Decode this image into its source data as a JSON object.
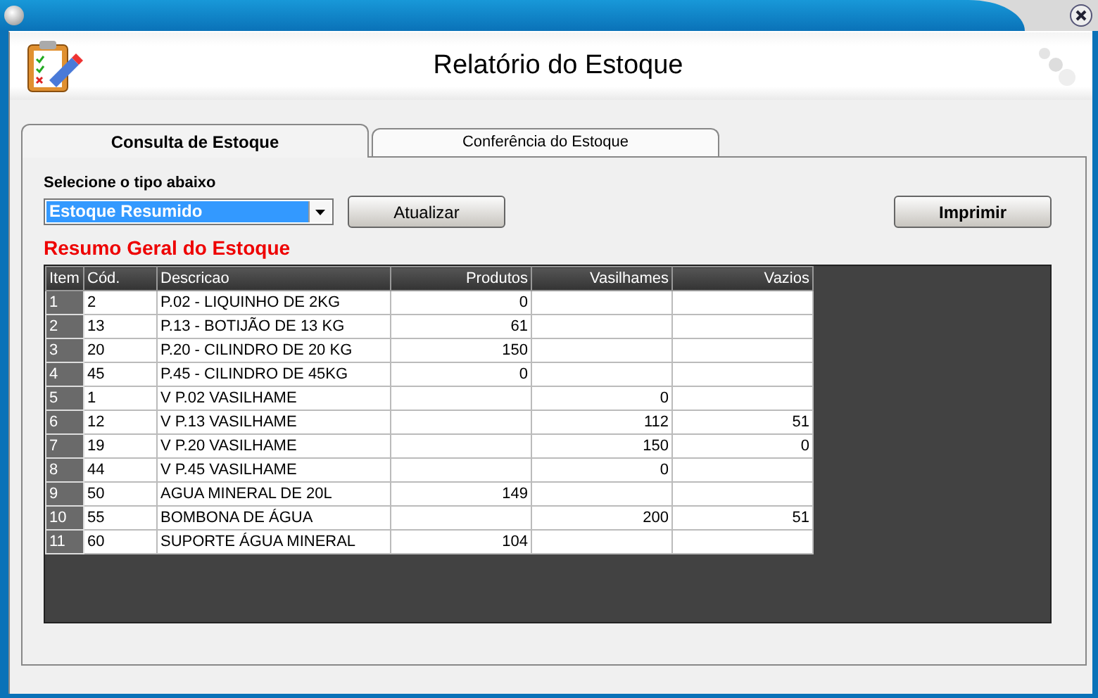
{
  "window": {
    "title": "Relatório do Estoque"
  },
  "tabs": [
    {
      "label": "Consulta de Estoque",
      "selected": true
    },
    {
      "label": "Conferência do Estoque",
      "selected": false
    }
  ],
  "type_select": {
    "label": "Selecione o tipo abaixo",
    "value": "Estoque Resumido"
  },
  "buttons": [
    {
      "label": "Atualizar",
      "kind": "update"
    },
    {
      "label": "Imprimir",
      "kind": "print"
    }
  ],
  "section_title": "Resumo Geral do Estoque",
  "table": {
    "columns": [
      {
        "label": "Item",
        "numeric": false
      },
      {
        "label": "Cód.",
        "numeric": false
      },
      {
        "label": "Descricao",
        "numeric": false
      },
      {
        "label": "Produtos",
        "numeric": true
      },
      {
        "label": "Vasilhames",
        "numeric": true
      },
      {
        "label": "Vazios",
        "numeric": true
      }
    ],
    "rows": [
      {
        "cells": [
          "1",
          "2",
          "P.02 - LIQUINHO DE 2KG",
          "0",
          null,
          null
        ]
      },
      {
        "cells": [
          "2",
          "13",
          "P.13 - BOTIJÃO DE 13 KG",
          "61",
          null,
          null
        ]
      },
      {
        "cells": [
          "3",
          "20",
          "P.20 - CILINDRO DE 20 KG",
          "150",
          null,
          null
        ]
      },
      {
        "cells": [
          "4",
          "45",
          "P.45 - CILINDRO DE 45KG",
          "0",
          null,
          null
        ]
      },
      {
        "cells": [
          "5",
          "1",
          "V P.02 VASILHAME",
          null,
          "0",
          null
        ]
      },
      {
        "cells": [
          "6",
          "12",
          "V P.13 VASILHAME",
          null,
          "112",
          "51"
        ]
      },
      {
        "cells": [
          "7",
          "19",
          "V P.20 VASILHAME",
          null,
          "150",
          "0"
        ]
      },
      {
        "cells": [
          "8",
          "44",
          "V P.45 VASILHAME",
          null,
          "0",
          null
        ]
      },
      {
        "cells": [
          "9",
          "50",
          "AGUA MINERAL DE 20L",
          "149",
          null,
          null
        ]
      },
      {
        "cells": [
          "10",
          "55",
          "BOMBONA DE ÁGUA",
          null,
          "200",
          "51"
        ]
      },
      {
        "cells": [
          "11",
          "60",
          "SUPORTE ÁGUA MINERAL",
          "104",
          null,
          null
        ]
      }
    ]
  }
}
